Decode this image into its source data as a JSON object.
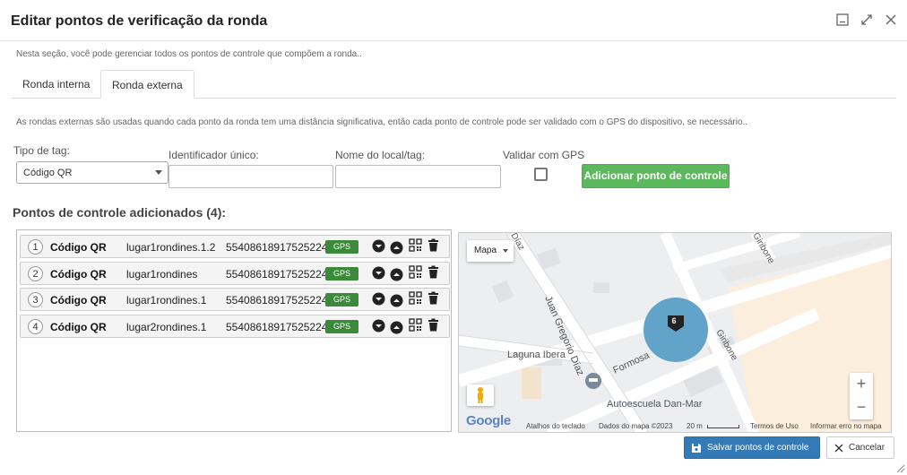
{
  "dialog": {
    "title": "Editar pontos de verificação da ronda",
    "subtitle": "Nesta seção, você pode gerenciar todos os pontos de controle que compõem a ronda..",
    "window_icons": [
      "minimize-icon",
      "expand-icon",
      "close-icon"
    ]
  },
  "tabs": [
    {
      "label": "Ronda interna",
      "active": false
    },
    {
      "label": "Ronda externa",
      "active": true
    }
  ],
  "description": "As rondas externas são usadas quando cada ponto da ronda tem uma distância significativa, então cada ponto de controle pode ser validado com o GPS do dispositivo, se necessário..",
  "form": {
    "tag_type_label": "Tipo de tag:",
    "tag_type_value": "Código QR",
    "unique_id_label": "Identificador único:",
    "unique_id_value": "",
    "location_label": "Nome do local/tag:",
    "location_value": "",
    "gps_label": "Validar com GPS",
    "gps_checked": false,
    "add_button": "Adicionar ponto de controle"
  },
  "section_title": "Pontos de controle adicionados (4):",
  "points": [
    {
      "num": "1",
      "type": "Código QR",
      "location": "lugar1rondines.1.2",
      "id": "55408618917525224",
      "gps": "GPS"
    },
    {
      "num": "2",
      "type": "Código QR",
      "location": "lugar1rondines",
      "id": "55408618917525224",
      "gps": "GPS"
    },
    {
      "num": "3",
      "type": "Código QR",
      "location": "lugar1rondines.1",
      "id": "55408618917525224",
      "gps": "GPS"
    },
    {
      "num": "4",
      "type": "Código QR",
      "location": "lugar2rondines.1",
      "id": "55408618917525224",
      "gps": "GPS"
    }
  ],
  "map": {
    "type_button": "Mapa",
    "cluster_count": "6",
    "streets": [
      "Juan Gregorio Díaz",
      "Laguna Ibera",
      "Formosa",
      "Giribone",
      "Giribone"
    ],
    "street_fragment": "Díaz",
    "poi": "Autoescuela Dan-Mar",
    "google": "Google",
    "keyboard": "Atalhos do teclado",
    "map_data": "Dados do mapa ©2023",
    "scale": "20 m",
    "terms": "Termos de Uso",
    "report": "Informar erro no mapa",
    "zoom_in": "+",
    "zoom_out": "−"
  },
  "footer": {
    "save_button": "Salvar pontos de controle",
    "cancel_button": "Cancelar"
  },
  "colors": {
    "green": "#5cb85c",
    "gps_badge": "#3a8a3a",
    "primary": "#337ab7",
    "cluster": "#5a9ec6"
  }
}
